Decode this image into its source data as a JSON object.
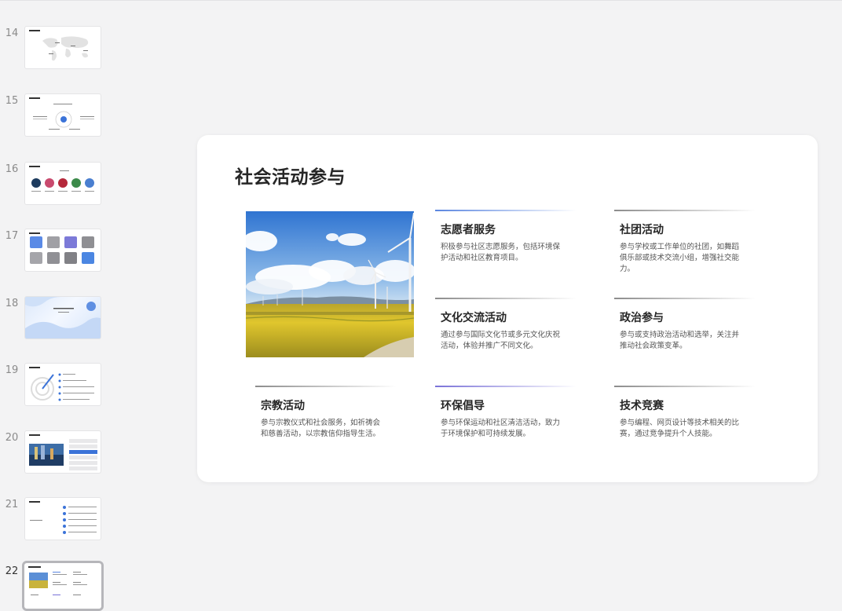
{
  "thumbnails": [
    {
      "number": "14"
    },
    {
      "number": "15"
    },
    {
      "number": "16"
    },
    {
      "number": "17"
    },
    {
      "number": "18"
    },
    {
      "number": "19"
    },
    {
      "number": "20"
    },
    {
      "number": "21"
    },
    {
      "number": "22",
      "active": true
    }
  ],
  "slide": {
    "title": "社会活动参与",
    "cards": [
      {
        "title": "志愿者服务",
        "text": "积极参与社区志愿服务，包括环境保护活动和社区教育项目。",
        "accent": "#5b86e0"
      },
      {
        "title": "社团活动",
        "text": "参与学校或工作单位的社团，如舞蹈俱乐部或技术交流小组，增强社交能力。",
        "accent": "#8c8c8c"
      },
      {
        "title": "文化交流活动",
        "text": "通过参与国际文化节或多元文化庆祝活动，体验并推广不同文化。",
        "accent": "#8c8c8c"
      },
      {
        "title": "政治参与",
        "text": "参与或支持政治活动和选举，关注并推动社会政策变革。",
        "accent": "#8c8c8c"
      },
      {
        "title": "宗教活动",
        "text": "参与宗教仪式和社会服务，如祈祷会和慈善活动，以宗教信仰指导生活。",
        "accent": "#8c8c8c"
      },
      {
        "title": "环保倡导",
        "text": "参与环保运动和社区清洁活动，致力于环境保护和可持续发展。",
        "accent": "#7a72d8"
      },
      {
        "title": "技术竞赛",
        "text": "参与编程、网页设计等技术相关的比赛，通过竞争提升个人技能。",
        "accent": "#8c8c8c"
      }
    ]
  }
}
